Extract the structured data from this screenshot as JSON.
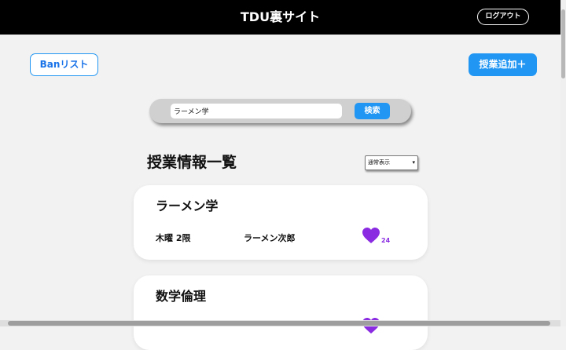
{
  "header": {
    "title": "TDU裏サイト",
    "logout_label": "ログアウト"
  },
  "toolbar": {
    "ban_list_label": "Banリスト",
    "add_class_label": "授業追加＋"
  },
  "search": {
    "value": "ラーメン学",
    "button_label": "検索"
  },
  "list": {
    "heading": "授業情報一覧",
    "display_mode": "通常表示",
    "courses": [
      {
        "name": "ラーメン学",
        "schedule": "木曜 2限",
        "teacher": "ラーメン次郎",
        "likes": "24"
      },
      {
        "name": "数学倫理",
        "schedule": "",
        "teacher": "",
        "likes": ""
      }
    ]
  },
  "colors": {
    "accent": "#2196f3",
    "heart": "#8a2be2",
    "header_bg": "#000000"
  },
  "icons": {
    "like": "heart-icon",
    "select": "chevron-down-icon"
  }
}
